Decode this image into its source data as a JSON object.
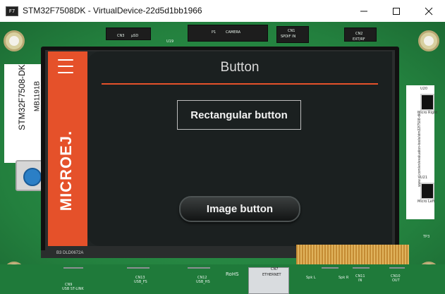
{
  "window": {
    "title": "STM32F7508DK - VirtualDevice-22d5d1bb1966",
    "app_icon_text": "F7"
  },
  "board": {
    "label_model": "STM32F7508-DK",
    "label_code": "MB1191B",
    "silk": {
      "cn3": "CN3",
      "psd": "μSD",
      "u19": "U19",
      "p1": "P1",
      "camera": "CAMERA",
      "cn1": "CN1",
      "spdif": "SPDIF IN",
      "cn2": "CN2",
      "ext_rf": "EXT/RF",
      "u20": "U20",
      "micro_right": "Micro Right",
      "u21": "U21",
      "micro_left": "Micro Left",
      "tp3": "TP3",
      "cn9": "CN9",
      "usb_stlink": "USB ST-LINK",
      "cn13": "CN13",
      "usb_fs": "USB_FS",
      "cn12": "CN12",
      "usb_hs": "USB_HS",
      "rohs": "RoHS",
      "cn7": "CN7",
      "ethernet": "ETHERNET",
      "cn11": "CN11",
      "cn10": "CN10",
      "out": "OUT",
      "spk_l": "Spk L",
      "spk_r": "Spk R",
      "in_label": "IN",
      "lcd_code": "B3 DLD0672A"
    },
    "right_url": "www.st.com/en/evaluation-tools/stm32f7508-dk."
  },
  "screen": {
    "logo": "MICROEJ.",
    "title": "Button",
    "rect_button_label": "Rectangular button",
    "image_button_label": "Image button"
  },
  "colors": {
    "accent": "#e5512a",
    "board_green": "#2a8f47",
    "screen_bg": "#1b2020"
  }
}
